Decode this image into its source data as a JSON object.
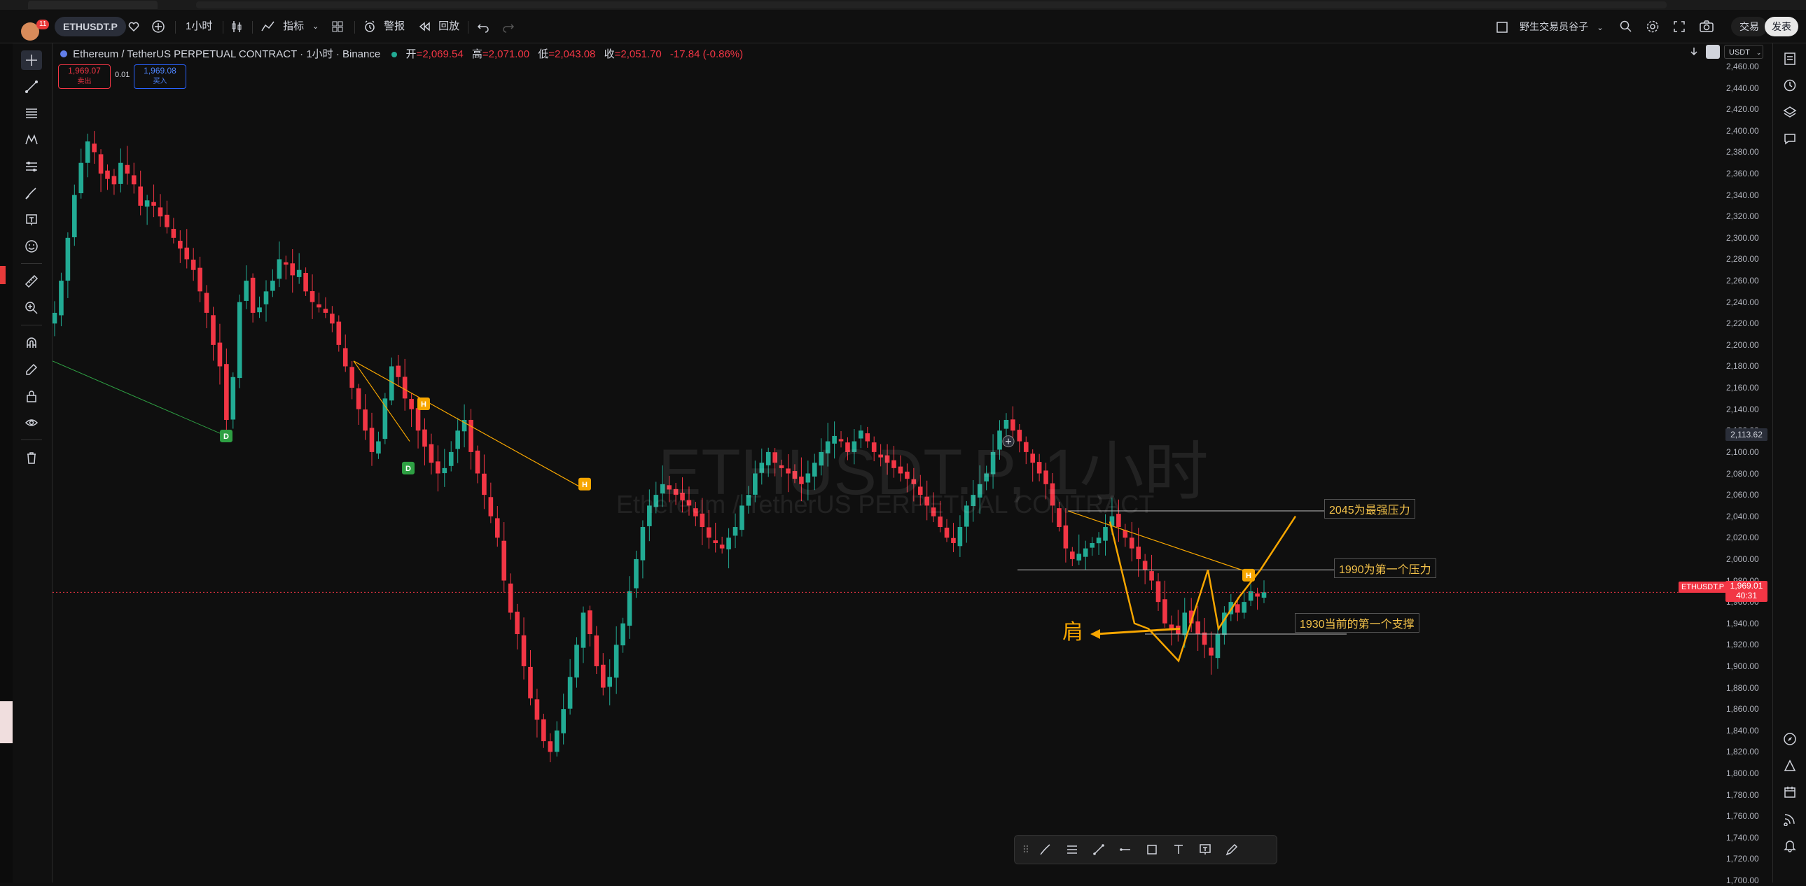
{
  "header": {
    "symbol": "ETHUSDT.P",
    "notification_count": "11",
    "interval": "1小时",
    "indicators_label": "指标",
    "alert_label": "警报",
    "replay_label": "回放",
    "account_label": "野生交易员谷子",
    "trade_label": "交易",
    "publish_label": "发表"
  },
  "legend": {
    "title": "Ethereum / TetherUS PERPETUAL CONTRACT · 1小时 · Binance",
    "open_label": "开",
    "open": "=2,069.54",
    "high_label": "高",
    "high": "=2,071.00",
    "low_label": "低",
    "low": "=2,043.08",
    "close_label": "收",
    "close": "=2,051.70",
    "change": "-17.84 (-0.86%)"
  },
  "order": {
    "sell_price": "1,969.07",
    "sell_label": "卖出",
    "spread": "0.01",
    "buy_price": "1,969.08",
    "buy_label": "买入"
  },
  "axis": {
    "currency": "USDT",
    "last_price": "1,969.01",
    "countdown": "40:31",
    "symbol_tag": "ETHUSDT.P",
    "crosshair_price": "2,113.62"
  },
  "watermark": {
    "line1": "ETHUSDT.P, 1小时",
    "line2": "Ethereum / TetherUS PERPETUAL CONTRACT"
  },
  "annotations": {
    "resistance_strong": "2045为最强压力",
    "resistance_first": "1990为第一个压力",
    "support_first": "1930当前的第一个支撑",
    "shoulder": "肩"
  },
  "chart_data": {
    "type": "candlestick",
    "ylim": [
      1700,
      2460
    ],
    "y_ticks": [
      "2,460.00",
      "2,440.00",
      "2,420.00",
      "2,400.00",
      "2,380.00",
      "2,360.00",
      "2,340.00",
      "2,320.00",
      "2,300.00",
      "2,280.00",
      "2,260.00",
      "2,240.00",
      "2,220.00",
      "2,200.00",
      "2,180.00",
      "2,160.00",
      "2,140.00",
      "2,120.00",
      "2,100.00",
      "2,080.00",
      "2,060.00",
      "2,040.00",
      "2,020.00",
      "2,000.00",
      "1,980.00",
      "1,960.00",
      "1,940.00",
      "1,920.00",
      "1,900.00",
      "1,880.00",
      "1,860.00",
      "1,840.00",
      "1,820.00",
      "1,800.00",
      "1,780.00",
      "1,760.00",
      "1,740.00",
      "1,720.00",
      "1,700.00"
    ],
    "y_values": [
      2460,
      2440,
      2420,
      2400,
      2380,
      2360,
      2340,
      2320,
      2300,
      2280,
      2260,
      2240,
      2220,
      2200,
      2180,
      2160,
      2140,
      2120,
      2100,
      2080,
      2060,
      2040,
      2020,
      2000,
      1980,
      1960,
      1940,
      1920,
      1900,
      1880,
      1860,
      1840,
      1820,
      1800,
      1780,
      1760,
      1740,
      1720,
      1700
    ],
    "close_path": [
      2230,
      2260,
      2300,
      2340,
      2370,
      2390,
      2380,
      2360,
      2355,
      2350,
      2370,
      2360,
      2350,
      2330,
      2335,
      2330,
      2320,
      2310,
      2300,
      2290,
      2280,
      2270,
      2250,
      2230,
      2200,
      2180,
      2130,
      2170,
      2240,
      2260,
      2230,
      2235,
      2250,
      2260,
      2280,
      2275,
      2265,
      2270,
      2250,
      2240,
      2235,
      2230,
      2220,
      2200,
      2180,
      2160,
      2140,
      2120,
      2100,
      2110,
      2150,
      2180,
      2170,
      2150,
      2140,
      2120,
      2105,
      2090,
      2080,
      2085,
      2100,
      2120,
      2130,
      2100,
      2080,
      2060,
      2040,
      2020,
      1980,
      1950,
      1930,
      1900,
      1870,
      1850,
      1830,
      1820,
      1840,
      1860,
      1890,
      1920,
      1950,
      1930,
      1900,
      1880,
      1890,
      1920,
      1940,
      1970,
      2000,
      2030,
      2050,
      2060,
      2070,
      2065,
      2060,
      2055,
      2050,
      2040,
      2030,
      2020,
      2015,
      2010,
      2020,
      2030,
      2050,
      2060,
      2080,
      2090,
      2100,
      2090,
      2085,
      2080,
      2075,
      2070,
      2080,
      2090,
      2100,
      2110,
      2115,
      2110,
      2100,
      2110,
      2120,
      2110,
      2100,
      2095,
      2090,
      2085,
      2080,
      2075,
      2070,
      2060,
      2050,
      2040,
      2030,
      2020,
      2015,
      2030,
      2050,
      2060,
      2070,
      2080,
      2100,
      2120,
      2130,
      2120,
      2110,
      2100,
      2090,
      2080,
      2070,
      2050,
      2030,
      2010,
      2000,
      2005,
      2010,
      2015,
      2020,
      2030,
      2040,
      2030,
      2020,
      2010,
      2000,
      1990,
      1980,
      1960,
      1940,
      1935,
      1930,
      1950,
      1940,
      1930,
      1920,
      1910,
      1930,
      1950,
      1960,
      1950,
      1960,
      1970,
      1965,
      1969
    ],
    "candle_count": 180,
    "series": [
      {
        "name": "Ethereum / TetherUS PERPETUAL CONTRACT",
        "color_up": "#22ab94",
        "color_down": "#f23645"
      }
    ],
    "horizontal_levels": [
      {
        "price": 2045,
        "label": "2045为最强压力"
      },
      {
        "price": 1990,
        "label": "1990为第一个压力"
      },
      {
        "price": 1930,
        "label": "1930当前的第一个支撑"
      }
    ],
    "markers": [
      {
        "text": "D",
        "price": 2115,
        "color": "#2ea043"
      },
      {
        "text": "D",
        "price": 2085,
        "color": "#2ea043"
      },
      {
        "text": "H",
        "price": 2145,
        "color": "#f7a600"
      },
      {
        "text": "H",
        "price": 2070,
        "color": "#f7a600"
      },
      {
        "text": "H",
        "price": 1985,
        "color": "#f7a600"
      }
    ],
    "colors": {
      "up": "#22ab94",
      "down": "#f23645",
      "trend": "#f7a600",
      "level": "#bfbfbf"
    }
  }
}
